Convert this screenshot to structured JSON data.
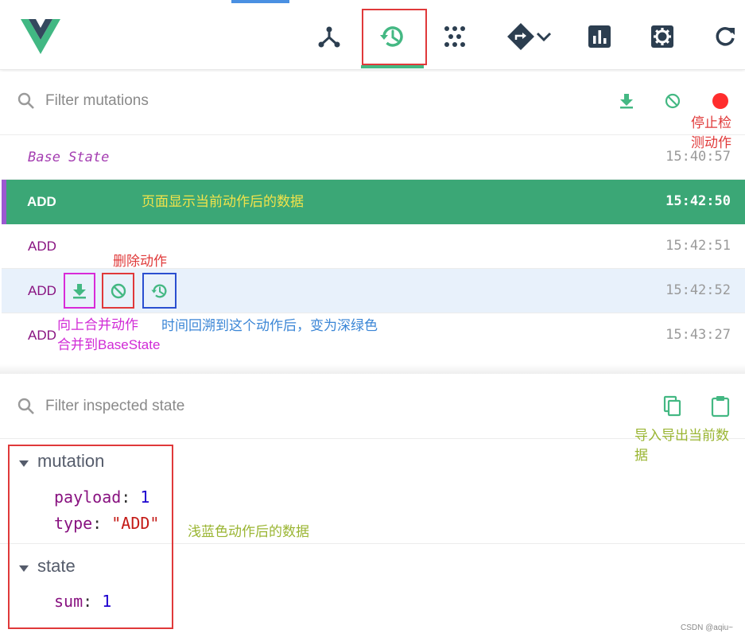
{
  "toolbar": {
    "tabs": [
      {
        "id": "components",
        "icon": "component-tree-icon"
      },
      {
        "id": "timeline",
        "icon": "history-icon",
        "active": true
      },
      {
        "id": "events",
        "icon": "events-grid-icon"
      },
      {
        "id": "routing",
        "icon": "routing-icon"
      },
      {
        "id": "performance",
        "icon": "bar-chart-icon"
      },
      {
        "id": "settings",
        "icon": "gear-icon"
      },
      {
        "id": "refresh",
        "icon": "refresh-icon"
      }
    ],
    "accent_color": "#44b883"
  },
  "mutations": {
    "filter_placeholder": "Filter mutations",
    "rows": [
      {
        "label": "Base State",
        "time": "15:40:57"
      },
      {
        "label": "ADD",
        "time": "15:42:50"
      },
      {
        "label": "ADD",
        "time": "15:42:51"
      },
      {
        "label": "ADD",
        "time": "15:42:52"
      },
      {
        "label": "ADD",
        "time": "15:43:27"
      }
    ]
  },
  "inspector": {
    "filter_placeholder": "Filter inspected state",
    "mutation_section": "mutation",
    "payload_key": "payload",
    "payload_value": "1",
    "type_key": "type",
    "type_value": "\"ADD\"",
    "state_section": "state",
    "sum_key": "sum",
    "sum_value": "1"
  },
  "annotations": {
    "stop_detect": "停止检\n测动作",
    "active_row": "页面显示当前动作后的数据",
    "delete": "删除动作",
    "merge": "向上合并动作\n合并到BaseState",
    "time_travel": "时间回溯到这个动作后，变为深绿色",
    "import_export": "导入导出当前数\n据",
    "hover_data": "浅蓝色动作后的数据"
  },
  "watermark": "CSDN @aqiu~"
}
